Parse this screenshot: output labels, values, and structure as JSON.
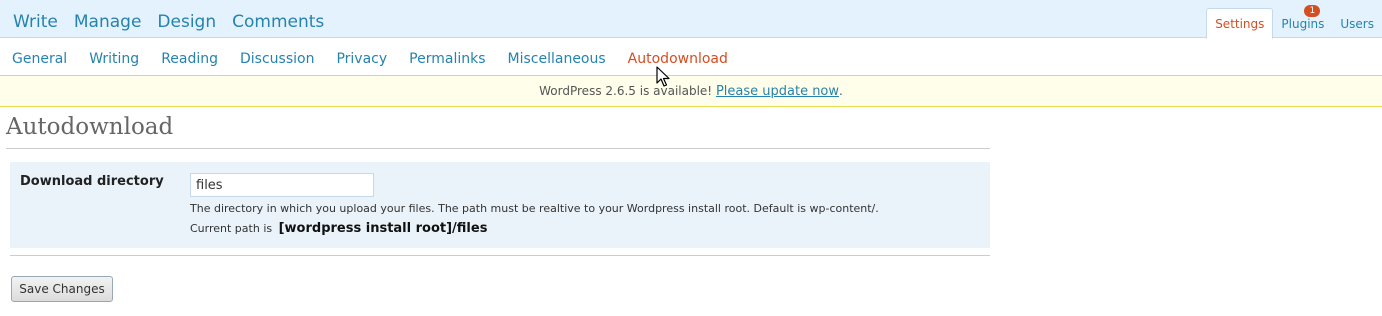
{
  "main_menu": {
    "items": [
      "Write",
      "Manage",
      "Design",
      "Comments"
    ]
  },
  "right_menu": {
    "settings_label": "Settings",
    "plugins_label": "Plugins",
    "plugins_badge": "1",
    "users_label": "Users"
  },
  "submenu": {
    "items": [
      "General",
      "Writing",
      "Reading",
      "Discussion",
      "Privacy",
      "Permalinks",
      "Miscellaneous",
      "Autodownload"
    ],
    "current": "Autodownload"
  },
  "update_nag": {
    "text": "WordPress 2.6.5 is available!",
    "link_text": "Please update now",
    "suffix": "."
  },
  "page": {
    "title": "Autodownload"
  },
  "form": {
    "label": "Download directory",
    "input_value": "files",
    "description": "The directory in which you upload your files. The path must be realtive to your Wordpress install root. Default is wp-content/.",
    "current_path_label": "Current path is",
    "current_path_value": "[wordpress install root]/files",
    "save_label": "Save Changes"
  },
  "colors": {
    "link": "#2583ad",
    "active": "#d54e21",
    "topbar_bg": "#e4f2fd",
    "nag_bg": "#fffeeb",
    "form_bg": "#eaf3fa"
  },
  "icons": {
    "cursor": "mouse-pointer-icon"
  }
}
